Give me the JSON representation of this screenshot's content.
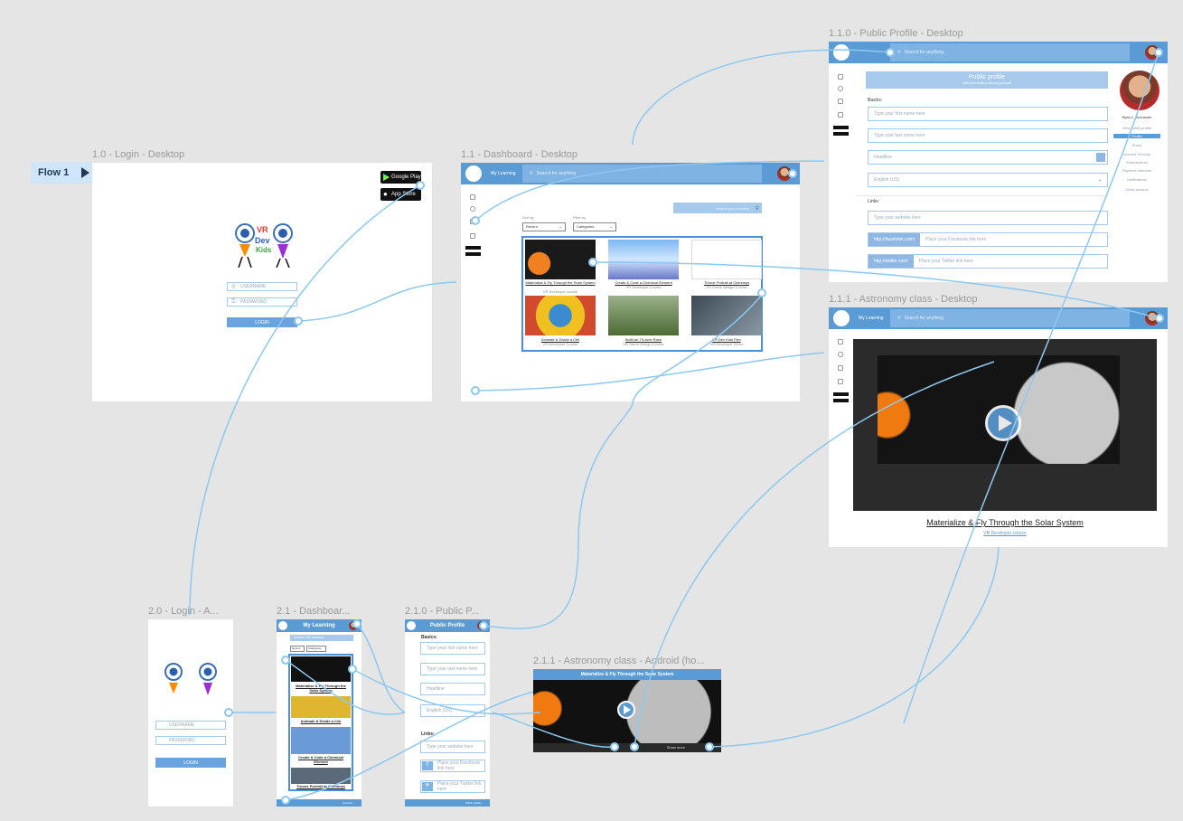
{
  "flow": {
    "label": "Flow 1"
  },
  "frames": {
    "login_desktop": "1.0 - Login - Desktop",
    "dashboard_desktop": "1.1 - Dashboard - Desktop",
    "profile_desktop": "1.1.0 - Public Profile - Desktop",
    "astronomy_desktop": "1.1.1 - Astronomy class - Desktop",
    "login_android": "2.0 - Login - A...",
    "dashboard_android": "2.1 - Dashboar...",
    "profile_android": "2.1.0 - Public P...",
    "astronomy_android": "2.1.1 - Astronomy class - Android (ho..."
  },
  "login": {
    "logo_top": "VR",
    "logo_mid": "Dev",
    "logo_bot": "Kids",
    "username": "USERNAME",
    "password": "PASSWORD",
    "login_btn": "LOGIN",
    "google_play_small": "GET IT ON",
    "google_play": "Google Play",
    "app_store_small": "Download on the",
    "app_store": "App Store"
  },
  "dashboard": {
    "title": "My Learning",
    "search_placeholder": "Search for anything",
    "find_course": "Search your courses",
    "sort_label": "Sort by",
    "sort_value": "Recent",
    "filter_label": "Filter by",
    "filter_value": "Categories",
    "courses": [
      {
        "title": "Materialize & Fly Through the Solar System",
        "sub": "VR Developer course"
      },
      {
        "title": "Create & Code a Chemical Element",
        "sub": "VR Developer Course"
      },
      {
        "title": "Throne Portrait at Chimneys",
        "sub": "VR Game Design Course"
      },
      {
        "title": "Animate & Divide a Cell",
        "sub": "VR Developer Course"
      },
      {
        "title": "Build an 79-Acre Race",
        "sub": "VR Game Design Course"
      },
      {
        "title": "VR Dev Kids Film",
        "sub": "VR Developer Demo"
      }
    ]
  },
  "profile": {
    "title": "Public profile",
    "subtitle": "Add information about yourself",
    "basics": "Basics:",
    "first_name": "Type your first name here",
    "last_name": "Type your last name here",
    "headline": "Headline",
    "country": "English (US)",
    "links": "Links:",
    "website": "Type your website here",
    "facebook_prefix": "http://facebook.com/",
    "facebook": "Place your Facebook link here",
    "twitter_prefix": "http://twitter.com/",
    "twitter": "Place your Twitter link here",
    "name": "Ryan L. Buchanan",
    "menu": [
      "View public profile",
      "Profile",
      "Photo",
      "Account Security",
      "Subscriptions",
      "Payment methods",
      "Notifications",
      "Close account"
    ]
  },
  "astronomy": {
    "title": "Materialize & Fly Through the Solar System",
    "sub": "VR Developer course",
    "nav_title": "My Learning",
    "search_placeholder": "Search for anything"
  },
  "android": {
    "dashboard_title": "My Learning",
    "search": "Search for courses",
    "sort": "Recent",
    "filter": "Categories",
    "courses": [
      "Materialize & Fly Through the Solar System",
      "Animate & Divide a Cell",
      "Create & Code a Chemical Element",
      "Throne Portrait at Chimneys"
    ],
    "profile_title": "Public Profile",
    "basics": "Basics:",
    "first_name": "Type your first name here",
    "last_name": "Type your last name here",
    "headline": "Headline",
    "country": "English (US)",
    "links": "Links:",
    "website": "Type your website here",
    "facebook": "Place your Facebook link here",
    "twitter": "Place your Twitter link here",
    "astronomy_title": "Materialize & Fly Through the Solar System",
    "astronomy_footer": "Show more",
    "login_username": "USERNAME",
    "login_password": "PASSWORD",
    "login_btn": "LOGIN",
    "dash_footer": "Account",
    "profile_footer": "Public profile"
  },
  "colors": {
    "accent": "#5b9bd5",
    "wire": "#8cc8ef",
    "canvas": "#e5e5e5"
  }
}
